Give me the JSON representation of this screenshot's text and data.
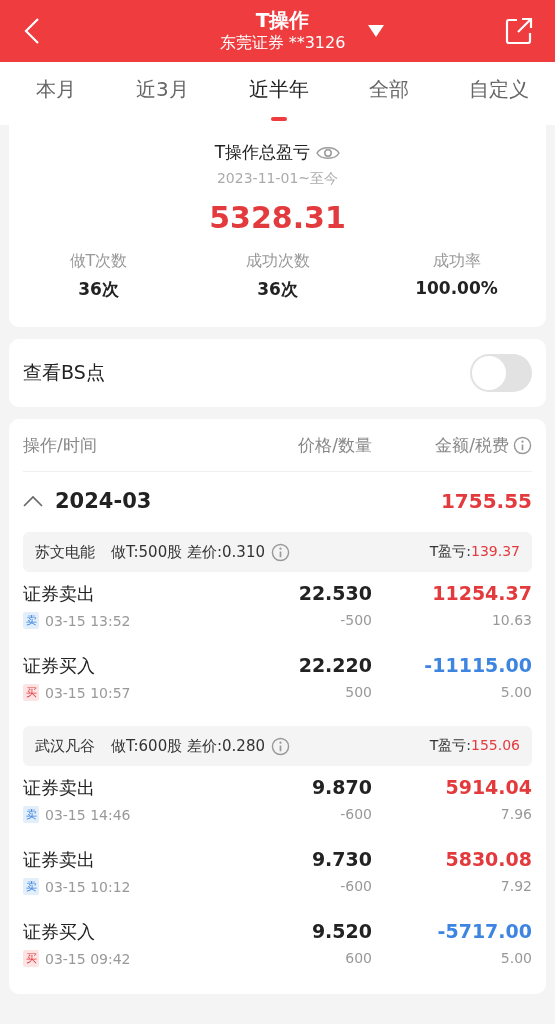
{
  "header": {
    "title": "T操作",
    "account": "东莞证券 **3126"
  },
  "tabs": [
    {
      "label": "本月",
      "selected": false
    },
    {
      "label": "近3月",
      "selected": false
    },
    {
      "label": "近半年",
      "selected": true
    },
    {
      "label": "全部",
      "selected": false
    },
    {
      "label": "自定义",
      "selected": false
    }
  ],
  "summary": {
    "title": "T操作总盈亏",
    "period": "2023-11-01~至今",
    "total": "5328.31",
    "stats": [
      {
        "label": "做T次数",
        "value": "36次"
      },
      {
        "label": "成功次数",
        "value": "36次"
      },
      {
        "label": "成功率",
        "value": "100.00%"
      }
    ]
  },
  "bs_toggle": {
    "label": "查看BS点",
    "on": false
  },
  "table": {
    "columns": [
      "操作/时间",
      "价格/数量",
      "金额/税费"
    ],
    "months": [
      {
        "month": "2024-03",
        "expanded": true,
        "total": "1755.55",
        "groups": [
          {
            "stock": "苏文电能",
            "detail": "做T:500股 差价:0.310",
            "pnl_label": "T盈亏:",
            "pnl": "139.37",
            "trades": [
              {
                "kind": "sell",
                "action": "证券卖出",
                "badge": "卖",
                "time": "03-15 13:52",
                "price": "22.530",
                "qty": "-500",
                "amount": "11254.37",
                "fee": "10.63"
              },
              {
                "kind": "buy",
                "action": "证券买入",
                "badge": "买",
                "time": "03-15 10:57",
                "price": "22.220",
                "qty": "500",
                "amount": "-11115.00",
                "fee": "5.00"
              }
            ]
          },
          {
            "stock": "武汉凡谷",
            "detail": "做T:600股 差价:0.280",
            "pnl_label": "T盈亏:",
            "pnl": "155.06",
            "trades": [
              {
                "kind": "sell",
                "action": "证券卖出",
                "badge": "卖",
                "time": "03-15 14:46",
                "price": "9.870",
                "qty": "-600",
                "amount": "5914.04",
                "fee": "7.96"
              },
              {
                "kind": "sell",
                "action": "证券卖出",
                "badge": "卖",
                "time": "03-15 10:12",
                "price": "9.730",
                "qty": "-600",
                "amount": "5830.08",
                "fee": "7.92"
              },
              {
                "kind": "buy",
                "action": "证券买入",
                "badge": "买",
                "time": "03-15 09:42",
                "price": "9.520",
                "qty": "600",
                "amount": "-5717.00",
                "fee": "5.00"
              }
            ]
          }
        ]
      }
    ]
  }
}
